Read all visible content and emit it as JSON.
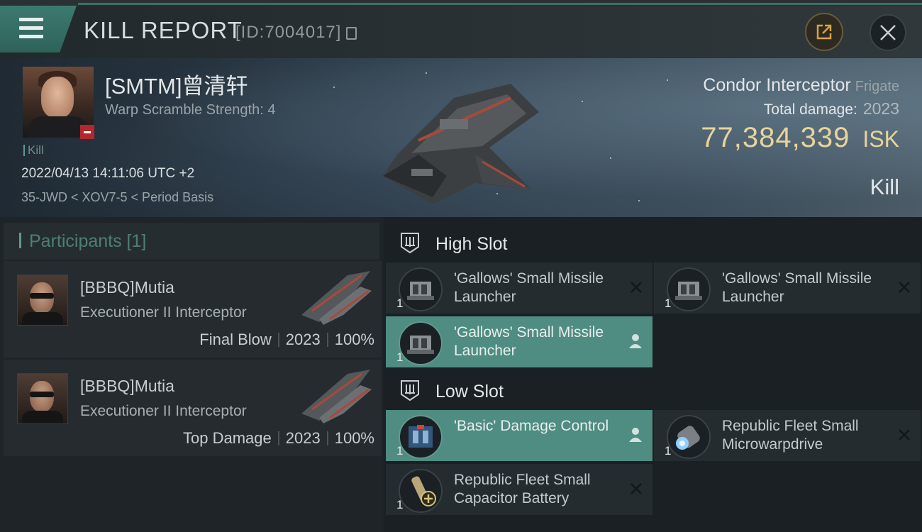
{
  "header": {
    "title": "KILL REPORT",
    "kill_id": "[ID:7004017]",
    "menu_icon": "hamburger-menu-icon",
    "export_icon": "share-export-icon",
    "close_icon": "close-x-icon"
  },
  "victim": {
    "name": "[SMTM]曾清轩",
    "warp_scramble": "Warp Scramble Strength: 4",
    "tag": "Kill",
    "time": "2022/04/13 14:11:06 UTC +2",
    "location": "35-JWD < XOV7-5 < Period Basis",
    "ship_name": "Condor Interceptor",
    "ship_class": "Frigate",
    "total_damage_label": "Total damage:",
    "total_damage": "2023",
    "isk_value": "77,384,339",
    "isk_unit": "ISK",
    "result": "Kill"
  },
  "participants": {
    "header": "Participants [1]",
    "items": [
      {
        "name": "[BBBQ]Mutia",
        "ship": "Executioner II Interceptor",
        "role": "Final Blow",
        "damage": "2023",
        "percent": "100%"
      },
      {
        "name": "[BBBQ]Mutia",
        "ship": "Executioner II Interceptor",
        "role": "Top Damage",
        "damage": "2023",
        "percent": "100%"
      }
    ]
  },
  "slots": {
    "high": {
      "label": "High Slot",
      "modules": [
        {
          "name": "'Gallows' Small Missile Launcher",
          "qty": "1",
          "status": "destroyed"
        },
        {
          "name": "'Gallows' Small Missile Launcher",
          "qty": "1",
          "status": "destroyed"
        },
        {
          "name": "'Gallows' Small Missile Launcher",
          "qty": "1",
          "status": "dropped"
        }
      ]
    },
    "low": {
      "label": "Low Slot",
      "modules": [
        {
          "name": "'Basic' Damage Control",
          "qty": "1",
          "status": "dropped"
        },
        {
          "name": "Republic Fleet Small Microwarpdrive",
          "qty": "1",
          "status": "destroyed"
        },
        {
          "name": "Republic Fleet Small Capacitor Battery",
          "qty": "1",
          "status": "destroyed"
        }
      ]
    }
  },
  "colors": {
    "accent_teal": "#4f8c82",
    "isk_gold": "#e8d49a",
    "danger_red": "#b3282a"
  }
}
